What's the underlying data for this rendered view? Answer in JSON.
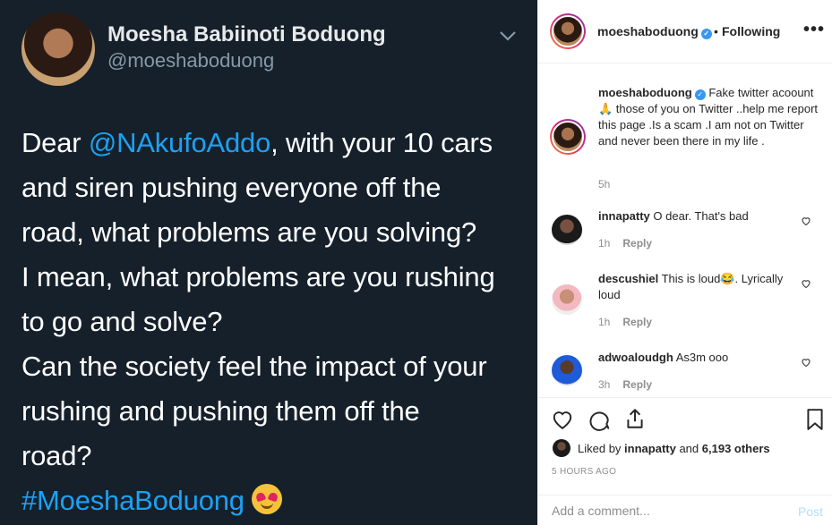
{
  "tweet": {
    "name": "Moesha Babiinoti Boduong",
    "handle": "@moeshaboduong",
    "body_lines": [
      {
        "mention": "@NAkufoAddo",
        "pre": "Dear ",
        "post": ", with your 10 cars"
      },
      {
        "text": "and siren pushing everyone off the"
      },
      {
        "text": "road, what problems are you solving?"
      },
      {
        "text": "I mean, what problems are you rushing"
      },
      {
        "text": "to go and solve?"
      },
      {
        "text": "Can the society feel the impact of your"
      },
      {
        "text": "rushing and pushing them off the"
      },
      {
        "text": "road?"
      }
    ],
    "hashtag": "#MoeshaBoduong"
  },
  "instagram": {
    "header": {
      "username": "moeshaboduong",
      "dot": "•",
      "following": "Following",
      "more": "•••"
    },
    "caption": {
      "username": "moeshaboduong",
      "text": "Fake twitter acoount 🙏 those of you on Twitter ..help me report this page .Is a scam .I am not on Twitter and never been there in my life .",
      "time": "5h"
    },
    "comments": [
      {
        "username": "innapatty",
        "text": "O dear. That's bad",
        "time": "1h",
        "reply": "Reply"
      },
      {
        "username": "descushiel",
        "text": "This is loud😂. Lyrically loud",
        "time": "1h",
        "reply": "Reply"
      },
      {
        "username": "adwoaloudgh",
        "text": "As3m ooo",
        "time": "3h",
        "reply": "Reply"
      }
    ],
    "likes": {
      "prefix": "Liked by ",
      "user": "innapatty",
      "middle": " and ",
      "count": "6,193 others"
    },
    "timestamp": "5 HOURS AGO",
    "add_comment": {
      "placeholder": "Add a comment...",
      "post": "Post"
    },
    "colors": {
      "accent": "#1da1f2",
      "tweet_bg": "#15202b",
      "post_disabled": "#b2dffc",
      "verified": "#3897f0"
    },
    "icons": [
      "heart-icon",
      "comment-icon",
      "share-icon",
      "bookmark-icon",
      "verified-icon",
      "chevron-down-icon",
      "more-icon"
    ]
  }
}
